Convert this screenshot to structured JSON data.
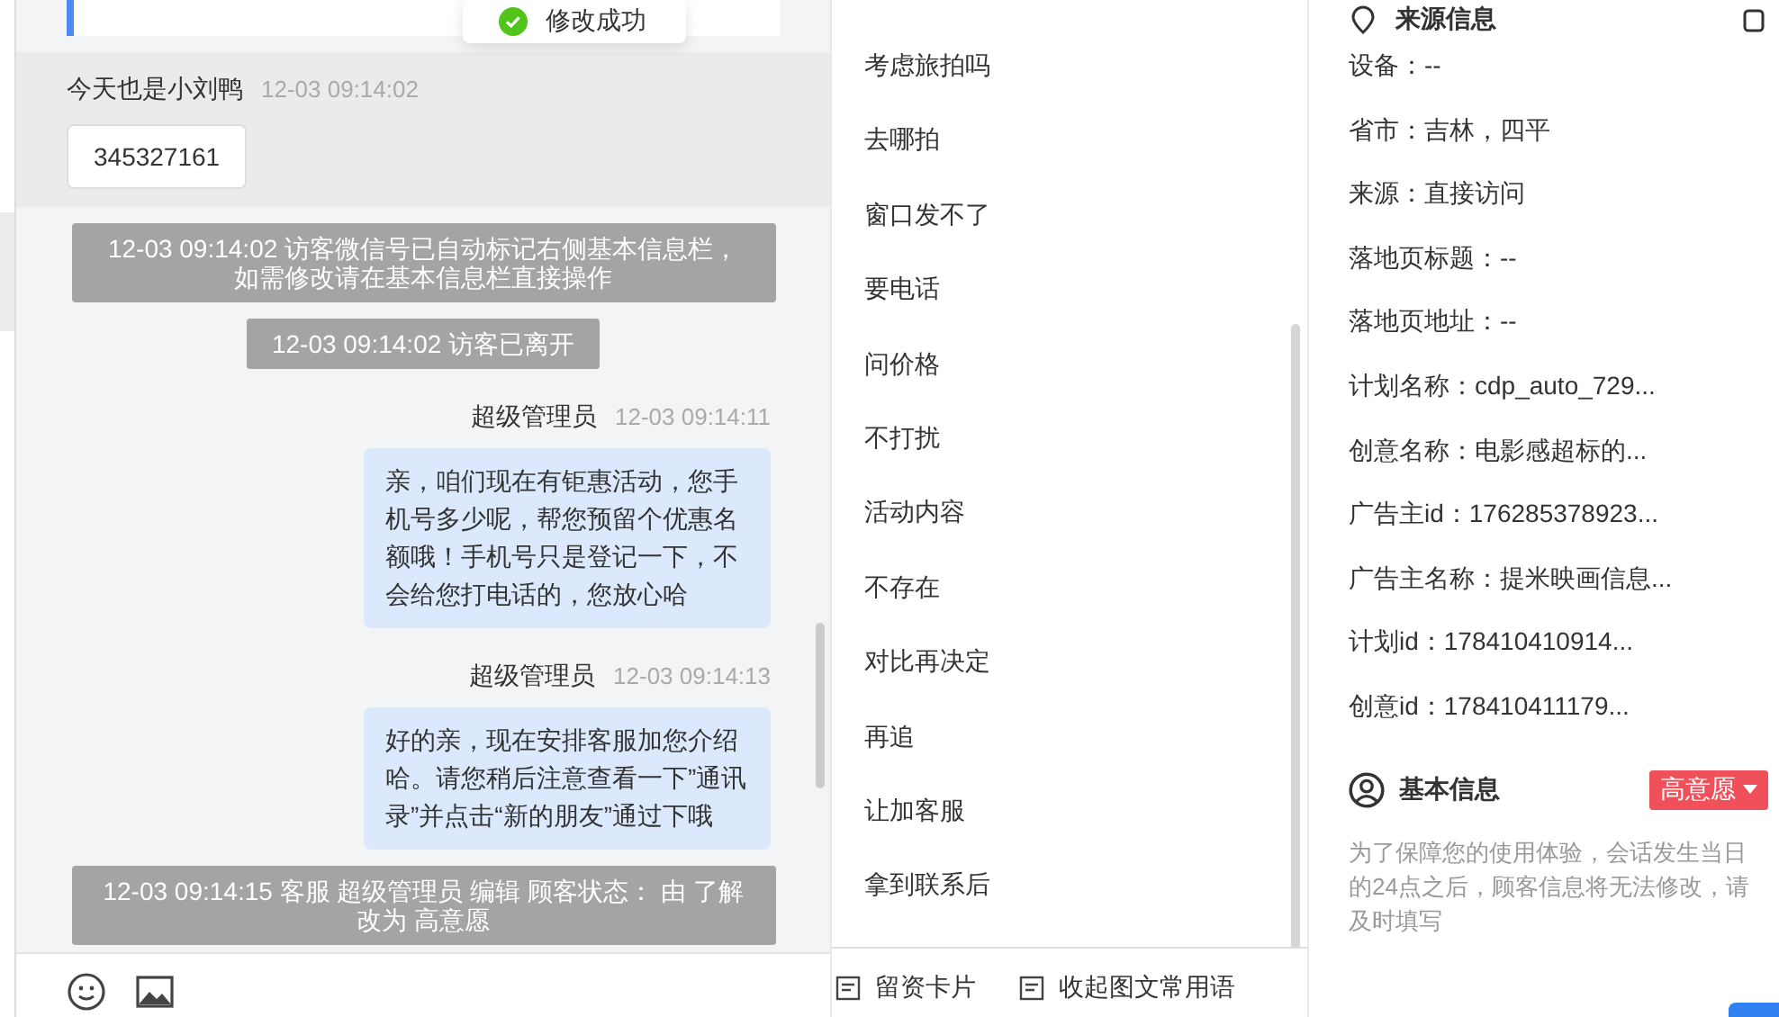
{
  "toast": {
    "text": "修改成功"
  },
  "chat": {
    "messages": [
      {
        "kind": "visitor",
        "name": "今天也是小刘鸭",
        "time": "12-03 09:14:02",
        "text": "345327161"
      },
      {
        "kind": "notice",
        "text": "12-03 09:14:02 访客微信号已自动标记右侧基本信息栏，如需修改请在基本信息栏直接操作"
      },
      {
        "kind": "event",
        "text": "12-03 09:14:02 访客已离开"
      },
      {
        "kind": "agent",
        "name": "超级管理员",
        "time": "12-03 09:14:11",
        "text": "亲，咱们现在有钜惠活动，您手机号多少呢，帮您预留个优惠名额哦！手机号只是登记一下，不会给您打电话的，您放心哈"
      },
      {
        "kind": "agent",
        "name": "超级管理员",
        "time": "12-03 09:14:13",
        "text": "好的亲，现在安排客服加您介绍哈。请您稍后注意查看一下”通讯录”并点击“新的朋友”通过下哦"
      },
      {
        "kind": "notice",
        "text": "12-03 09:14:15 客服 超级管理员 编辑 顾客状态： 由 了解改为 高意愿"
      }
    ]
  },
  "phrases": {
    "items": [
      "考虑旅拍吗",
      "去哪拍",
      "窗口发不了",
      "要电话",
      "问价格",
      "不打扰",
      "活动内容",
      "不存在",
      "对比再决定",
      "再追",
      "让加客服",
      "拿到联系后"
    ],
    "tools": [
      "留资卡片",
      "收起图文常用语"
    ]
  },
  "source_info": {
    "title": "来源信息",
    "fields": [
      "设备：--",
      "省市：吉林，四平",
      "来源：直接访问",
      "落地页标题：--",
      "落地页地址：--",
      "计划名称：cdp_auto_729...",
      "创意名称：电影感超标的...",
      "广告主id：176285378923...",
      "广告主名称：提米映画信息...",
      "计划id：178410410914...",
      "创意id：178410411179..."
    ]
  },
  "basic_info": {
    "title": "基本信息",
    "status": "高意愿",
    "note": "为了保障您的使用体验，会话发生当日的24点之后，顾客信息将无法修改，请及时填写"
  }
}
